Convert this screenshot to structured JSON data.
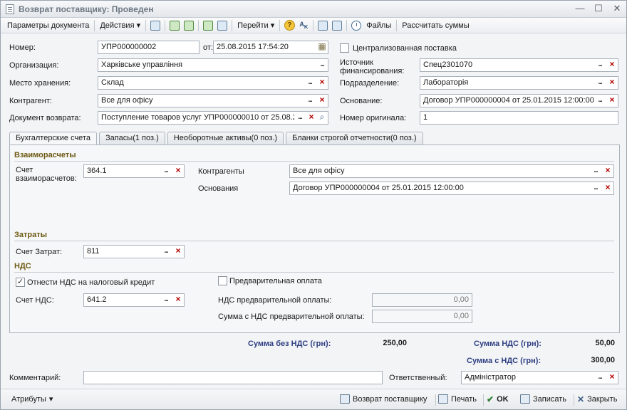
{
  "window": {
    "title": "Возврат поставщику: Проведен",
    "controls": [
      "—",
      "☐",
      "✕"
    ]
  },
  "toolbar": {
    "params": "Параметры документа",
    "actions": "Действия",
    "goto": "Перейти",
    "files": "Файлы",
    "calc": "Рассчитать суммы"
  },
  "header": {
    "number_label": "Номер:",
    "number": "УПР000000002",
    "from_label": "от:",
    "date": "25.08.2015 17:54:20",
    "centralized_label": "Централизованная поставка",
    "centralized_checked": false,
    "org_label": "Организация:",
    "org": "Харківське управління",
    "source_label": "Источник финансирования:",
    "source": "Спец2301070",
    "storage_label": "Место хранения:",
    "storage": "Склад",
    "division_label": "Подразделение:",
    "division": "Лабораторія",
    "contractor_label": "Контрагент:",
    "contractor": "Все для офісу",
    "basis_label": "Основание:",
    "basis": "Договор УПР000000004 от 25.01.2015 12:00:00",
    "return_doc_label": "Документ возврата:",
    "return_doc": "Поступление товаров услуг УПР000000010 от 25.08.2",
    "orig_number_label": "Номер оригинала:",
    "orig_number": "1"
  },
  "tabs": [
    {
      "label": "Бухгалтерские счета",
      "active": true
    },
    {
      "label": "Запасы(1 поз.)",
      "active": false
    },
    {
      "label": "Необоротные активы(0 поз.)",
      "active": false
    },
    {
      "label": "Бланки строгой отчетности(0 поз.)",
      "active": false
    }
  ],
  "settlements": {
    "title": "Взаиморасчеты",
    "account_label": "Счет взаиморасчетов:",
    "account": "364.1",
    "contractors_label": "Контрагенты",
    "contractors": "Все для офісу",
    "bases_label": "Основания",
    "bases": "Договор УПР000000004 от 25.01.2015 12:00:00"
  },
  "costs": {
    "title": "Затраты",
    "account_label": "Счет Затрат:",
    "account": "811"
  },
  "vat": {
    "title": "НДС",
    "tax_credit_label": "Отнести НДС на налоговый кредит",
    "tax_credit_checked": true,
    "prepayment_label": "Предварительная оплата",
    "prepayment_checked": false,
    "account_label": "Счет НДС:",
    "account": "641.2",
    "prepay_vat_label": "НДС предварительной оплаты:",
    "prepay_vat": "0,00",
    "prepay_sum_label": "Сумма с НДС предварительной оплаты:",
    "prepay_sum": "0,00"
  },
  "totals": {
    "without_vat_label": "Сумма без НДС (грн):",
    "without_vat": "250,00",
    "vat_label": "Сумма НДС (грн):",
    "vat": "50,00",
    "with_vat_label": "Сумма с НДС (грн):",
    "with_vat": "300,00"
  },
  "footer": {
    "comment_label": "Комментарий:",
    "comment": "",
    "responsible_label": "Ответственный:",
    "responsible": "Адміністратор"
  },
  "bottom": {
    "attributes": "Атрибуты",
    "return": "Возврат поставщику",
    "print": "Печать",
    "ok": "OK",
    "save": "Записать",
    "close": "Закрыть"
  }
}
